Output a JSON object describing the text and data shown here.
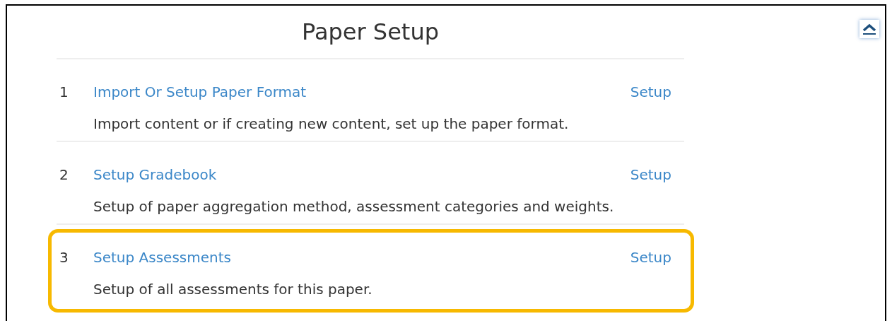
{
  "title": "Paper Setup",
  "steps": [
    {
      "number": "1",
      "name": "Import Or Setup Paper Format",
      "action": "Setup",
      "description": "Import content or if creating new content, set up the paper format.",
      "highlighted": false
    },
    {
      "number": "2",
      "name": "Setup Gradebook",
      "action": "Setup",
      "description": "Setup of paper aggregation method, assessment categories and weights.",
      "highlighted": false
    },
    {
      "number": "3",
      "name": "Setup Assessments",
      "action": "Setup",
      "description": "Setup of all assessments for this paper.",
      "highlighted": true
    }
  ]
}
